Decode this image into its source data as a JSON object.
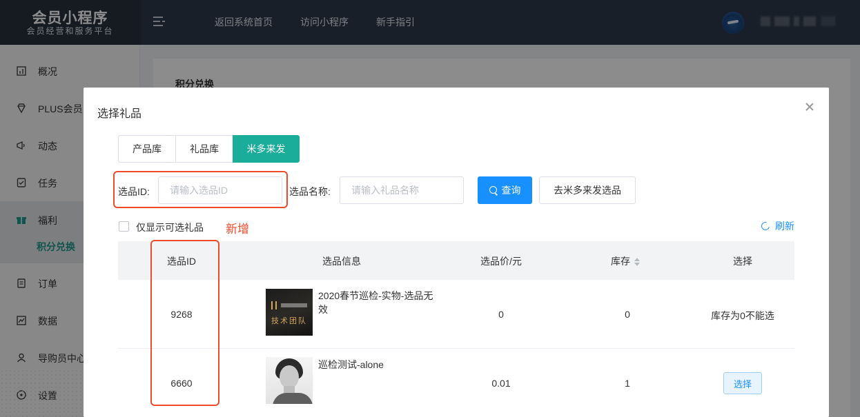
{
  "header": {
    "logo_title": "会员小程序",
    "logo_subtitle": "会员经营和服务平台",
    "nav": [
      "返回系统首页",
      "访问小程序",
      "新手指引"
    ],
    "colors": {
      "bg": "#2d3a4b",
      "logo_bg": "#28323f"
    }
  },
  "sidebar": {
    "items": [
      {
        "label": "概况",
        "icon": "chart-icon"
      },
      {
        "label": "PLUS会员",
        "icon": "diamond-icon"
      },
      {
        "label": "动态",
        "icon": "megaphone-icon"
      },
      {
        "label": "任务",
        "icon": "task-icon"
      },
      {
        "label": "福利",
        "icon": "gift-icon"
      },
      {
        "label": "订单",
        "icon": "order-icon"
      },
      {
        "label": "数据",
        "icon": "data-icon"
      },
      {
        "label": "导购员中心",
        "icon": "user-icon"
      },
      {
        "label": "设置",
        "icon": "settings-icon"
      }
    ],
    "active_sub": "积分兑换",
    "accent": "#1c9c8b"
  },
  "page": {
    "title": "积分兑换"
  },
  "modal": {
    "title": "选择礼品",
    "tabs": [
      {
        "label": "产品库",
        "active": false
      },
      {
        "label": "礼品库",
        "active": false
      },
      {
        "label": "米多来发",
        "active": true
      }
    ],
    "filters": {
      "id_label": "选品ID:",
      "id_placeholder": "请输入选品ID",
      "name_label": "选品名称:",
      "name_placeholder": "请输入礼品名称",
      "query_button": "查询",
      "go_button": "去米多来发选品"
    },
    "checkbox_label": "仅显示可选礼品",
    "annotation_new": "新增",
    "refresh_label": "刷新",
    "table": {
      "headers": [
        "选品ID",
        "选品信息",
        "选品价/元",
        "库存",
        "选择"
      ],
      "rows": [
        {
          "id": "9268",
          "name": "2020春节巡检-实物-选品无效",
          "thumb_text": "技术团队",
          "price": "0",
          "stock": "0",
          "select": "库存为0不能选"
        },
        {
          "id": "6660",
          "name": "巡检测试-alone",
          "thumb_text": "",
          "price": "0.01",
          "stock": "1",
          "select": "选择"
        }
      ]
    },
    "colors": {
      "tab_active": "#1aae9a",
      "primary": "#1890ff",
      "annotation": "#f04a2b"
    }
  }
}
